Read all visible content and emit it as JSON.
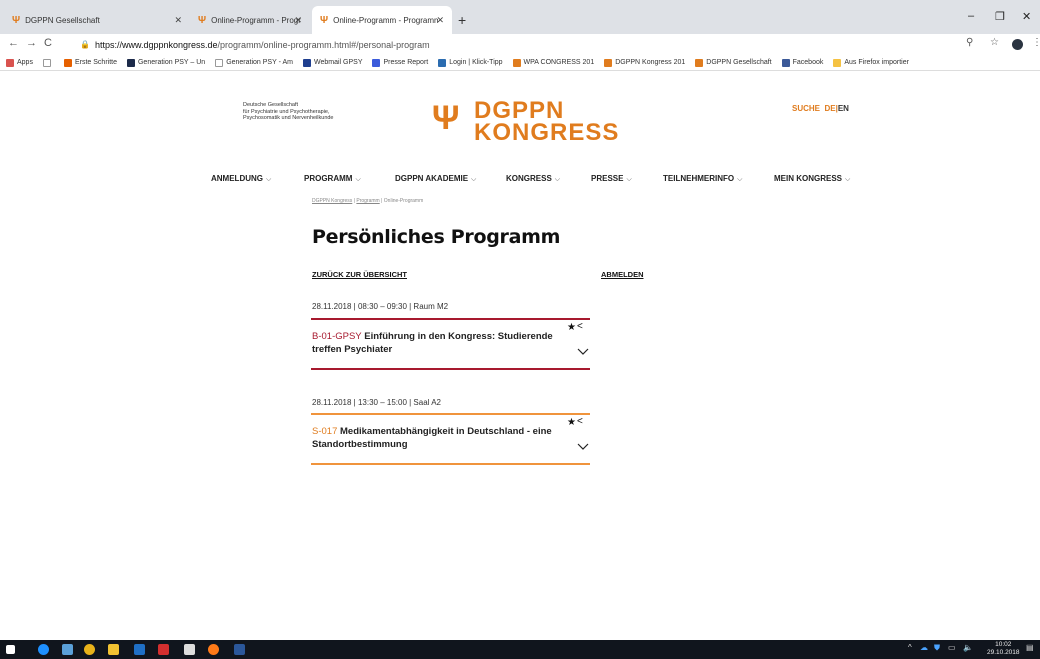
{
  "browser": {
    "tabs": [
      {
        "label": "DGPPN Gesellschaft"
      },
      {
        "label": "Online-Programm - Programm -"
      },
      {
        "label": "Online-Programm - Programm -"
      }
    ],
    "new_tab": "+",
    "window_controls": [
      "–",
      "❐",
      "✕"
    ],
    "url_host": "https://www.dgppnkongress.de",
    "url_path": "/programm/online-programm.html#/personal-program",
    "bookmarks": [
      {
        "label": "Apps",
        "color": "#d9534f"
      },
      {
        "label": "",
        "color": "#ffffff"
      },
      {
        "label": "Erste Schritte",
        "color": "#e66000"
      },
      {
        "label": "Generation PSY – Un",
        "color": "#1c2a4a"
      },
      {
        "label": "Generation PSY - Am",
        "color": "#ffffff"
      },
      {
        "label": "Webmail GPSY",
        "color": "#1f3f8f"
      },
      {
        "label": "Presse Report",
        "color": "#3b5bdb"
      },
      {
        "label": "Login | Klick-Tipp",
        "color": "#2b6cb0"
      },
      {
        "label": "WPA CONGRESS 201",
        "color": "#e07c1e"
      },
      {
        "label": "DGPPN Kongress 201",
        "color": "#e07c1e"
      },
      {
        "label": "DGPPN Gesellschaft",
        "color": "#e07c1e"
      },
      {
        "label": "Facebook",
        "color": "#3b5998"
      },
      {
        "label": "Aus Firefox importier",
        "color": "#f5c242"
      }
    ]
  },
  "header": {
    "society_line1": "Deutsche Gesellschaft",
    "society_line2": "für Psychiatrie und Psychotherapie,",
    "society_line3": "Psychosomatik und Nervenheilkunde",
    "logo_symbol": "Ψ",
    "logo_line1": "DGPPN",
    "logo_line2": "KONGRESS",
    "search": "SUCHE",
    "lang_de": "DE",
    "lang_sep": "|",
    "lang_en": "EN"
  },
  "nav": {
    "items": [
      {
        "label": "ANMELDUNG"
      },
      {
        "label": "PROGRAMM"
      },
      {
        "label": "DGPPN AKADEMIE"
      },
      {
        "label": "KONGRESS"
      },
      {
        "label": "PRESSE"
      },
      {
        "label": "TEILNEHMERINFO"
      },
      {
        "label": "MEIN KONGRESS"
      }
    ],
    "chevron": "⌵"
  },
  "breadcrumb": {
    "item1": "DGPPN Kongress",
    "sep": " | ",
    "item2": "Programm",
    "item3": "Online-Programm"
  },
  "page": {
    "title": "Persönliches Programm",
    "back_link": "ZURÜCK ZUR ÜBERSICHT",
    "logout_link": "ABMELDEN"
  },
  "sessions": [
    {
      "meta": "28.11.2018 | 08:30 – 09:30 | Raum M2",
      "code": "B-01-GPSY",
      "title": "Einführung in den Kongress: Studierende treffen Psychiater",
      "color": "#a7192e",
      "code_color": "#a7192e"
    },
    {
      "meta": "28.11.2018 | 13:30 – 15:00 | Saal A2",
      "code": "S-017",
      "title": "Medikamentabhängigkeit in Deutschland - eine Standortbestimmung",
      "color": "#f0943c",
      "code_color": "#e07c1e"
    }
  ],
  "icons": {
    "star": "★",
    "share": "<"
  },
  "taskbar": {
    "time": "10:02",
    "date": "29.10.2018"
  }
}
